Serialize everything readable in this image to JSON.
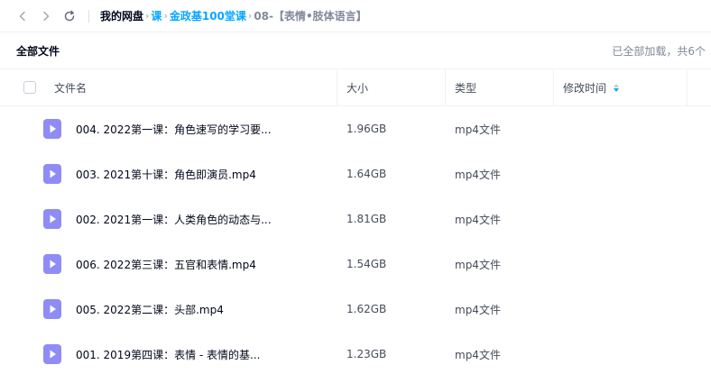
{
  "nav": {
    "back_icon": "chevron-left-icon",
    "forward_icon": "chevron-right-icon",
    "refresh_icon": "refresh-icon"
  },
  "breadcrumb": {
    "root": "我的网盘",
    "items": [
      "课",
      "金政基100堂课"
    ],
    "current": "08-【表情•肢体语言】",
    "separator": "›"
  },
  "header": {
    "title": "全部文件",
    "status": "已全部加载，共6个"
  },
  "columns": {
    "name": "文件名",
    "size": "大小",
    "type": "类型",
    "modified": "修改时间"
  },
  "files": [
    {
      "name": "004. 2022第一课：角色速写的学习要...",
      "size": "1.96GB",
      "type": "mp4文件"
    },
    {
      "name": "003. 2021第十课：角色即演员.mp4",
      "size": "1.64GB",
      "type": "mp4文件"
    },
    {
      "name": "002. 2021第一课：人类角色的动态与...",
      "size": "1.81GB",
      "type": "mp4文件"
    },
    {
      "name": "006. 2022第三课：五官和表情.mp4",
      "size": "1.54GB",
      "type": "mp4文件"
    },
    {
      "name": "005. 2022第二课：头部.mp4",
      "size": "1.62GB",
      "type": "mp4文件"
    },
    {
      "name": "001. 2019第四课：表情 - 表情的基...",
      "size": "1.23GB",
      "type": "mp4文件"
    }
  ],
  "colors": {
    "accent": "#06a7ff",
    "video_icon": "#8f8cf6",
    "text_primary": "#03081a",
    "text_secondary": "#818999"
  }
}
